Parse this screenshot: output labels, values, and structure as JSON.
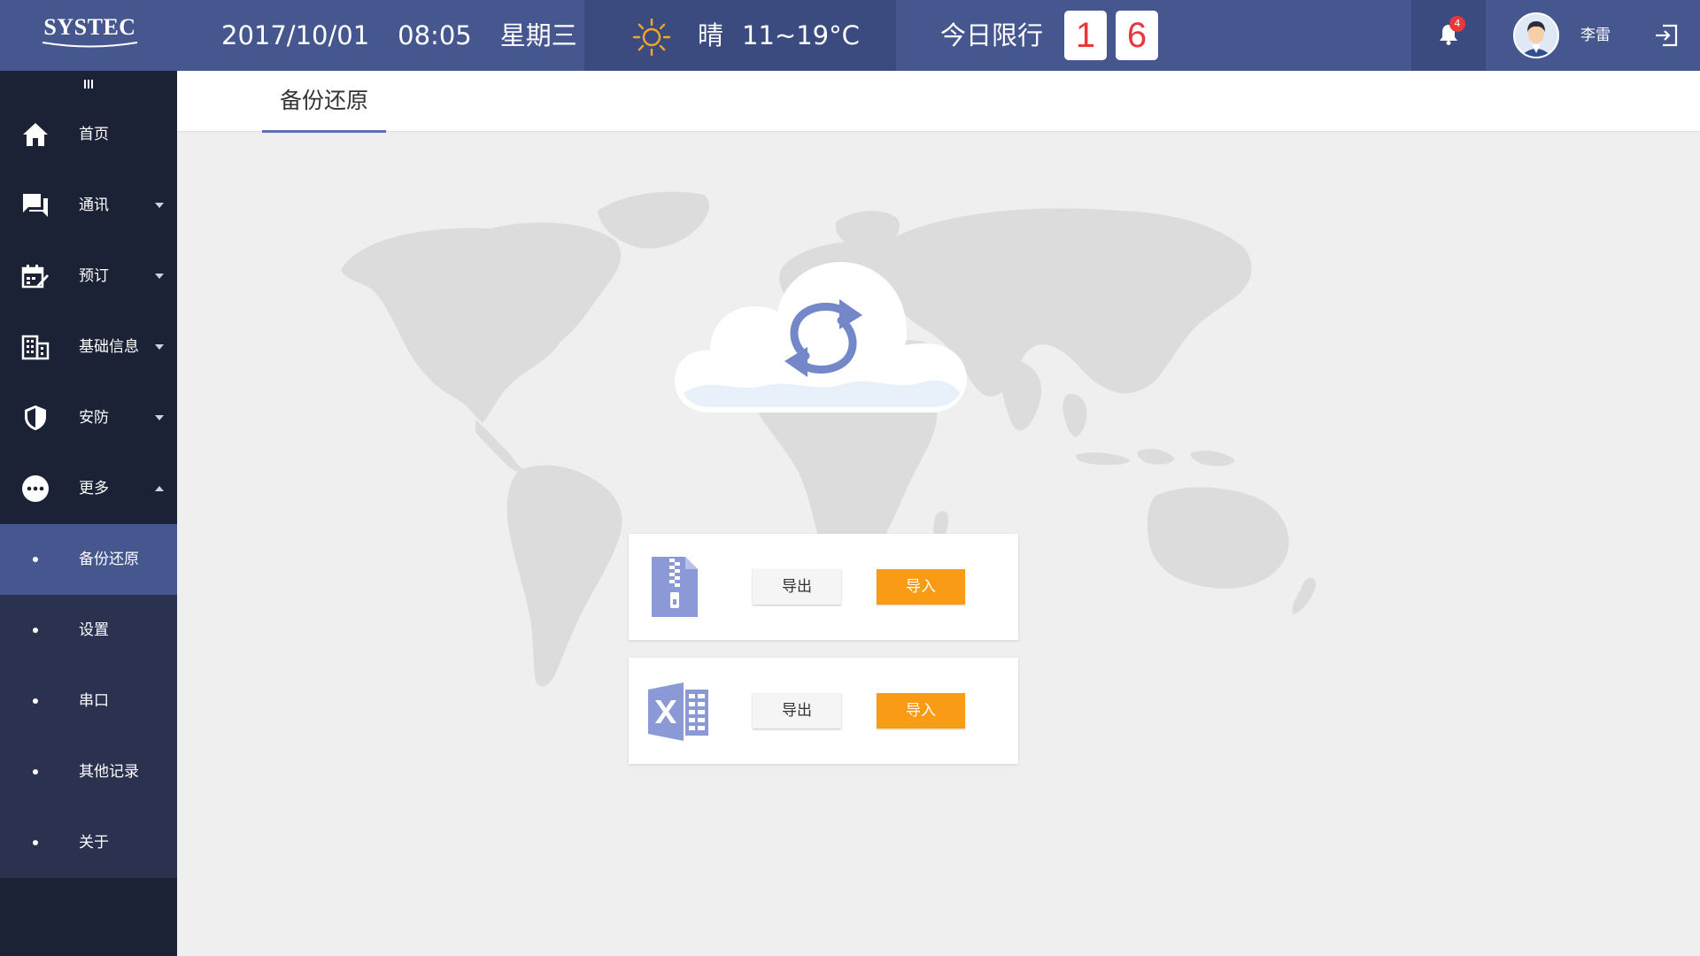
{
  "header": {
    "logo_text": "SYSTEC",
    "date": "2017/10/01",
    "time": "08:05",
    "weekday": "星期三",
    "weather": {
      "condition": "晴",
      "temperature": "11~19°C",
      "icon": "sun-icon"
    },
    "traffic_limit": {
      "label": "今日限行",
      "digits": [
        "1",
        "6"
      ]
    },
    "notifications": {
      "count": "4",
      "icon": "bell-icon"
    },
    "user": {
      "name": "李雷",
      "icon": "avatar"
    },
    "logout_icon": "logout-icon"
  },
  "sidebar": {
    "collapse_icon": "menu-icon",
    "items": [
      {
        "label": "首页",
        "icon": "home-icon",
        "has_caret": false
      },
      {
        "label": "通讯",
        "icon": "chat-icon",
        "has_caret": true
      },
      {
        "label": "预订",
        "icon": "booking-icon",
        "has_caret": true
      },
      {
        "label": "基础信息",
        "icon": "building-icon",
        "has_caret": true
      },
      {
        "label": "安防",
        "icon": "shield-icon",
        "has_caret": true
      },
      {
        "label": "更多",
        "icon": "more-icon",
        "has_caret": true,
        "expanded": true
      }
    ],
    "submenu": [
      {
        "label": "备份还原",
        "active": true
      },
      {
        "label": "设置"
      },
      {
        "label": "串口"
      },
      {
        "label": "其他记录"
      },
      {
        "label": "关于"
      }
    ]
  },
  "main": {
    "tab": "备份还原",
    "center_icon": "cloud-sync-icon",
    "cards": [
      {
        "icon": "zip-file-icon",
        "export_label": "导出",
        "import_label": "导入"
      },
      {
        "icon": "excel-file-icon",
        "export_label": "导出",
        "import_label": "导入"
      }
    ]
  },
  "colors": {
    "header_bg": "#46578f",
    "header_dark": "#3c4b7f",
    "sidebar_bg": "#1c2236",
    "submenu_bg": "#2a3250",
    "active_item": "#46578f",
    "import_button": "#f99b14",
    "plate_digit": "#e8383d",
    "icon_accent": "#8b9ad6"
  }
}
